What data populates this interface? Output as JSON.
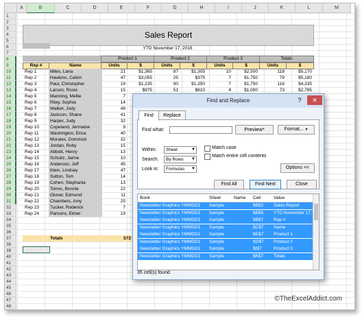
{
  "columns": [
    "A",
    "B",
    "C",
    "D",
    "E",
    "F",
    "G",
    "H",
    "I",
    "J",
    "K",
    "L",
    "M"
  ],
  "selected_column": "B",
  "row_numbers": [
    "1",
    "2",
    "3",
    "4",
    "5",
    "6",
    "7",
    "8",
    "9",
    "10",
    "11",
    "12",
    "13",
    "14",
    "15",
    "16",
    "17",
    "18",
    "19",
    "20",
    "21",
    "22",
    "23",
    "24",
    "25",
    "26",
    "27",
    "28",
    "29",
    "30",
    "31",
    "32",
    "33",
    "34",
    "35",
    "36",
    "37",
    "38",
    "39",
    "40",
    "41",
    "42",
    "43",
    "44",
    "45",
    "46",
    "47",
    "48"
  ],
  "report": {
    "title": "Sales Report",
    "subtitle": "YTD November 17, 2016",
    "product_headers": [
      "Product 1",
      "Product 2",
      "Product 3",
      "Totals"
    ],
    "units_label": "Units",
    "dollar_label": "$",
    "rep_header": "Rep #",
    "name_header": "Name",
    "totals_label": "Totals",
    "totals_units": "572"
  },
  "rows": [
    {
      "rep": "Rep 1",
      "name": "Miles, Lana",
      "u1": "21",
      "d1": "$1,365",
      "u2": "87",
      "d2": "$1,305",
      "u3": "10",
      "d3": "$2,500",
      "ut": "118",
      "dt": "$5,170"
    },
    {
      "rep": "Rep 2",
      "name": "Hawkins, Calvin",
      "u1": "47",
      "d1": "$3,055",
      "u2": "25",
      "d2": "$375",
      "u3": "7",
      "d3": "$1,750",
      "ut": "79",
      "dt": "$5,180"
    },
    {
      "rep": "Rep 3",
      "name": "Paul, Christopher",
      "u1": "19",
      "d1": "$1,235",
      "u2": "90",
      "d2": "$1,350",
      "u3": "7",
      "d3": "$1,750",
      "ut": "116",
      "dt": "$4,335"
    },
    {
      "rep": "Rep 4",
      "name": "Larson, Rosie",
      "u1": "15",
      "d1": "$975",
      "u2": "51",
      "d2": "$810",
      "u3": "4",
      "d3": "$1,000",
      "ut": "73",
      "dt": "$2,785"
    },
    {
      "rep": "Rep 5",
      "name": "Manning, Mellie",
      "u1": "7",
      "d1": "",
      "u2": "",
      "d2": "",
      "u3": "",
      "d3": "",
      "ut": "",
      "dt": ""
    },
    {
      "rep": "Rep 6",
      "name": "Riley, Sophia",
      "u1": "14",
      "d1": "",
      "u2": "",
      "d2": "",
      "u3": "",
      "d3": "",
      "ut": "",
      "dt": ""
    },
    {
      "rep": "Rep 7",
      "name": "Walker, Jody",
      "u1": "49",
      "d1": "",
      "u2": "",
      "d2": "",
      "u3": "",
      "d3": "",
      "ut": "",
      "dt": ""
    },
    {
      "rep": "Rep 8",
      "name": "Jackson, Shane",
      "u1": "41",
      "d1": "",
      "u2": "",
      "d2": "",
      "u3": "",
      "d3": "",
      "ut": "",
      "dt": ""
    },
    {
      "rep": "Rep 9",
      "name": "Harper, Judy",
      "u1": "32",
      "d1": "",
      "u2": "",
      "d2": "",
      "u3": "",
      "d3": "",
      "ut": "",
      "dt": ""
    },
    {
      "rep": "Rep 10",
      "name": "Copeland, Jermaine",
      "u1": "9",
      "d1": "",
      "u2": "",
      "d2": "",
      "u3": "",
      "d3": "",
      "ut": "",
      "dt": ""
    },
    {
      "rep": "Rep 11",
      "name": "Washington, Erica",
      "u1": "40",
      "d1": "",
      "u2": "",
      "d2": "",
      "u3": "",
      "d3": "",
      "ut": "",
      "dt": ""
    },
    {
      "rep": "Rep 12",
      "name": "Morales, Dominick",
      "u1": "32",
      "d1": "",
      "u2": "",
      "d2": "",
      "u3": "",
      "d3": "",
      "ut": "",
      "dt": ""
    },
    {
      "rep": "Rep 13",
      "name": "Jordan, Ruby",
      "u1": "15",
      "d1": "",
      "u2": "",
      "d2": "",
      "u3": "",
      "d3": "",
      "ut": "",
      "dt": ""
    },
    {
      "rep": "Rep 14",
      "name": "Abbott, Henry",
      "u1": "13",
      "d1": "",
      "u2": "",
      "d2": "",
      "u3": "",
      "d3": "",
      "ut": "",
      "dt": ""
    },
    {
      "rep": "Rep 15",
      "name": "Schultz, Jaime",
      "u1": "10",
      "d1": "",
      "u2": "",
      "d2": "",
      "u3": "",
      "d3": "",
      "ut": "",
      "dt": ""
    },
    {
      "rep": "Rep 16",
      "name": "Anderson, Jeff",
      "u1": "45",
      "d1": "",
      "u2": "",
      "d2": "",
      "u3": "",
      "d3": "",
      "ut": "",
      "dt": ""
    },
    {
      "rep": "Rep 17",
      "name": "Klein, Lindsey",
      "u1": "47",
      "d1": "",
      "u2": "",
      "d2": "",
      "u3": "",
      "d3": "",
      "ut": "",
      "dt": ""
    },
    {
      "rep": "Rep 18",
      "name": "Sutton, Tom",
      "u1": "14",
      "d1": "",
      "u2": "",
      "d2": "",
      "u3": "",
      "d3": "",
      "ut": "",
      "dt": ""
    },
    {
      "rep": "Rep 19",
      "name": "Cohen, Stephanie",
      "u1": "13",
      "d1": "",
      "u2": "",
      "d2": "",
      "u3": "",
      "d3": "",
      "ut": "",
      "dt": ""
    },
    {
      "rep": "Rep 20",
      "name": "Torres, Bonnie",
      "u1": "22",
      "d1": "",
      "u2": "",
      "d2": "",
      "u3": "",
      "d3": "",
      "ut": "",
      "dt": ""
    },
    {
      "rep": "Rep 21",
      "name": "Glover, Edmund",
      "u1": "11",
      "d1": "",
      "u2": "",
      "d2": "",
      "u3": "",
      "d3": "",
      "ut": "",
      "dt": ""
    },
    {
      "rep": "Rep 22",
      "name": "Chambers, Amy",
      "u1": "25",
      "d1": "",
      "u2": "",
      "d2": "",
      "u3": "",
      "d3": "",
      "ut": "",
      "dt": ""
    },
    {
      "rep": "Rep 23",
      "name": "Tucker, Roderick",
      "u1": "7",
      "d1": "",
      "u2": "",
      "d2": "",
      "u3": "",
      "d3": "",
      "ut": "",
      "dt": ""
    },
    {
      "rep": "Rep 24",
      "name": "Parsons, Elmer",
      "u1": "19",
      "d1": "",
      "u2": "",
      "d2": "",
      "u3": "",
      "d3": "",
      "ut": "",
      "dt": ""
    }
  ],
  "dialog": {
    "title": "Find and Replace",
    "help": "?",
    "close": "✕",
    "tab_find": "Find",
    "tab_replace": "Replace",
    "find_what_label": "Find what:",
    "find_what_value": "",
    "preview_button": "Preview*",
    "format_button": "Format...",
    "within_label": "Within:",
    "within_value": "Sheet",
    "search_label": "Search:",
    "search_value": "By Rows",
    "lookin_label": "Look in:",
    "lookin_value": "Formulas",
    "match_case": "Match case",
    "match_entire": "Match entire cell contents",
    "options_button": "Options <<",
    "find_all": "Find All",
    "find_next": "Find Next",
    "close_button": "Close",
    "result_headers": [
      "Book",
      "Sheet",
      "Name",
      "Cell",
      "Value"
    ],
    "results": [
      {
        "book": "Newsletter Graphics YMMDD1",
        "sheet": "Sample",
        "name": "",
        "cell": "$B$2",
        "value": "Sales Report"
      },
      {
        "book": "Newsletter Graphics YMMDD1",
        "sheet": "Sample",
        "name": "",
        "cell": "$B$5",
        "value": "YTD November 17, 2016"
      },
      {
        "book": "Newsletter Graphics YMMDD1",
        "sheet": "Sample",
        "name": "",
        "cell": "$B$7",
        "value": "Rep #"
      },
      {
        "book": "Newsletter Graphics YMMDD1",
        "sheet": "Sample",
        "name": "",
        "cell": "$C$7",
        "value": "Name"
      },
      {
        "book": "Newsletter Graphics YMMDD1",
        "sheet": "Sample",
        "name": "",
        "cell": "$E$7",
        "value": "Product 1"
      },
      {
        "book": "Newsletter Graphics YMMDD1",
        "sheet": "Sample",
        "name": "",
        "cell": "$G$7",
        "value": "Product 2"
      },
      {
        "book": "Newsletter Graphics YMMDD1",
        "sheet": "Sample",
        "name": "",
        "cell": "$I$7",
        "value": "Product 3"
      },
      {
        "book": "Newsletter Graphics YMMDD1",
        "sheet": "Sample",
        "name": "",
        "cell": "$K$7",
        "value": "Totals"
      }
    ],
    "status": "35 cell(s) found"
  },
  "watermark": "©TheExcelAddict.com",
  "colors": {
    "accent_blue": "#3399ff",
    "header_yellow": "#fce4a8",
    "excel_green": "#217346"
  }
}
